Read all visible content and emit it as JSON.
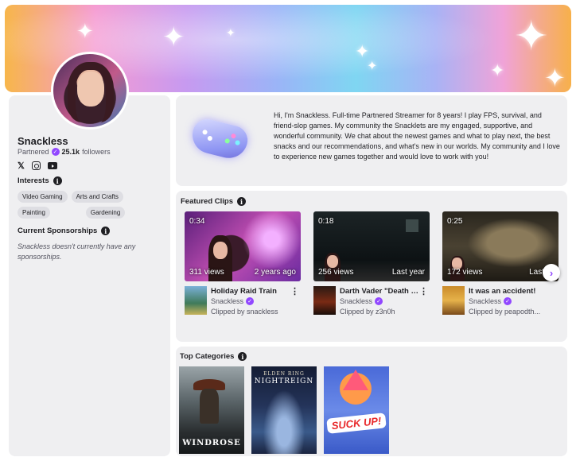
{
  "profile": {
    "name": "Snackless",
    "partner_label": "Partnered",
    "followers_count": "25.1k",
    "followers_label": "followers"
  },
  "socials": [
    "X",
    "Instagram",
    "YouTube"
  ],
  "interests": {
    "title": "Interests",
    "tags": [
      "Video Gaming",
      "Arts and Crafts",
      "Painting",
      "Gardening"
    ]
  },
  "sponsorships": {
    "title": "Current Sponsorships",
    "empty_text": "Snackless doesn't currently have any sponsorships."
  },
  "about": {
    "text": "Hi, I'm Snackless. Full-time Partnered Streamer for 8 years! I play FPS, survival, and friend-slop games. My community the Snacklets are my engaged, supportive, and wonderful community. We chat about the newest games and what to play next, the best snacks and our recommendations, and what's new in our worlds. My community and I love to experience new games together and would love to work with you!"
  },
  "featured_clips": {
    "title": "Featured Clips",
    "clips": [
      {
        "duration": "0:34",
        "views": "311 views",
        "ago": "2 years ago",
        "title": "Holiday Raid Train",
        "channel": "Snackless",
        "clipped_by": "Clipped by snackless"
      },
      {
        "duration": "0:18",
        "views": "256 views",
        "ago": "Last year",
        "title": "Darth Vader \"Death D...",
        "channel": "Snackless",
        "clipped_by": "Clipped by z3n0h"
      },
      {
        "duration": "0:25",
        "views": "172 views",
        "ago": "Last",
        "title": "It was an accident!",
        "channel": "Snackless",
        "clipped_by": "Clipped by peapodth..."
      }
    ]
  },
  "top_categories": {
    "title": "Top Categories",
    "categories": [
      {
        "label": "WINDROSE"
      },
      {
        "label": "NIGHTREIGN",
        "sublabel": "ELDEN RING"
      },
      {
        "label": "SUCK UP!"
      }
    ]
  },
  "colors": {
    "accent": "#9147ff",
    "card": "#efeff1",
    "text": "#1f1f23"
  }
}
